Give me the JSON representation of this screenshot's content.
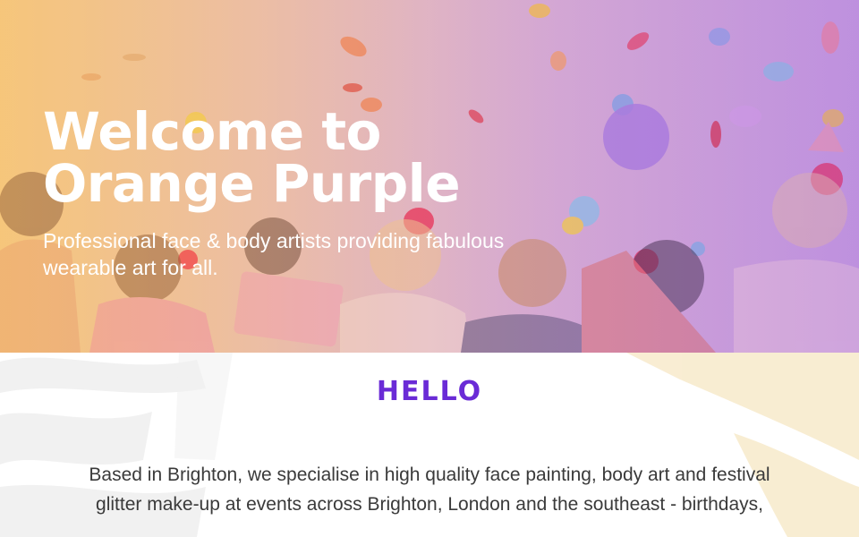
{
  "hero": {
    "title_line1": "Welcome to",
    "title_line2": "Orange Purple",
    "subtitle_line1": "Professional face & body artists providing fabulous",
    "subtitle_line2": "wearable art for all."
  },
  "intro": {
    "heading": "HELLO",
    "body_line1": "Based in Brighton, we specialise in high quality face painting, body art and festival",
    "body_line2": "glitter make-up at events across Brighton, London and the southeast - birthdays,"
  },
  "colors": {
    "brand_purple": "#6a2bd6",
    "hero_orange": "#f6cf8c",
    "hero_purple": "#c9a3e0",
    "body_text": "#3a3a3a"
  }
}
